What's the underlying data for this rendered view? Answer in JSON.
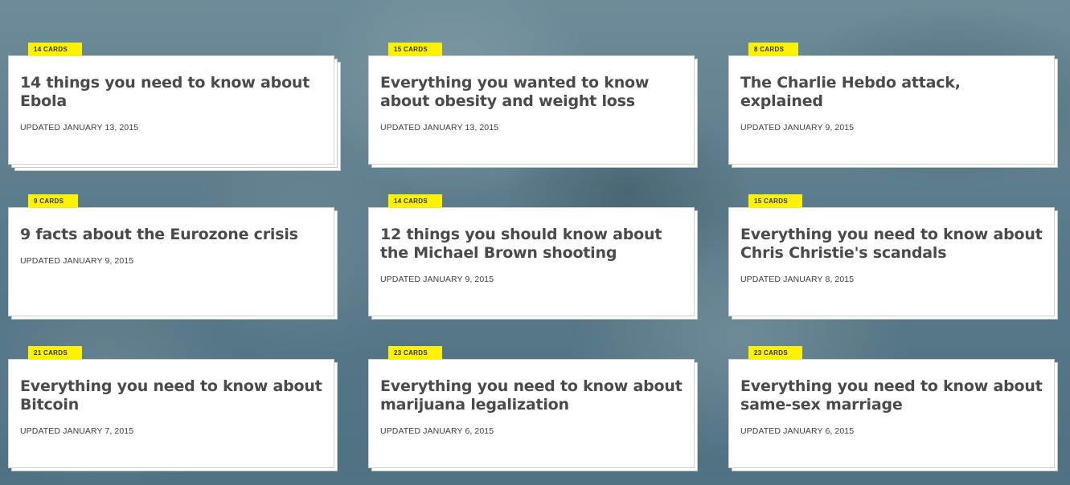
{
  "cards": [
    {
      "badge": "14 CARDS",
      "title": "14 things you need to know about Ebola",
      "updated": "UPDATED JANUARY 13, 2015",
      "stack_depth": 2
    },
    {
      "badge": "15 CARDS",
      "title": "Everything you wanted to know about obesity and weight loss",
      "updated": "UPDATED JANUARY 13, 2015",
      "stack_depth": 1
    },
    {
      "badge": "8 CARDS",
      "title": "The Charlie Hebdo attack, explained",
      "updated": "UPDATED JANUARY 9, 2015",
      "stack_depth": 1
    },
    {
      "badge": "9 CARDS",
      "title": "9 facts about the Eurozone crisis",
      "updated": "UPDATED JANUARY 9, 2015",
      "stack_depth": 1
    },
    {
      "badge": "14 CARDS",
      "title": "12 things you should know about the Michael Brown shooting",
      "updated": "UPDATED JANUARY 9, 2015",
      "stack_depth": 1
    },
    {
      "badge": "15 CARDS",
      "title": "Everything you need to know about Chris Christie's scandals",
      "updated": "UPDATED JANUARY 8, 2015",
      "stack_depth": 1
    },
    {
      "badge": "21 CARDS",
      "title": "Everything you need to know about Bitcoin",
      "updated": "UPDATED JANUARY 7, 2015",
      "stack_depth": 1
    },
    {
      "badge": "23 CARDS",
      "title": "Everything you need to know about marijuana legalization",
      "updated": "UPDATED JANUARY 6, 2015",
      "stack_depth": 1
    },
    {
      "badge": "23 CARDS",
      "title": "Everything you need to know about same-sex marriage",
      "updated": "UPDATED JANUARY 6, 2015",
      "stack_depth": 1
    }
  ],
  "colors": {
    "badge_bg": "#fff200",
    "card_bg": "#ffffff",
    "title_text": "#4a4a4a",
    "page_bg": "#5f7f8d"
  }
}
